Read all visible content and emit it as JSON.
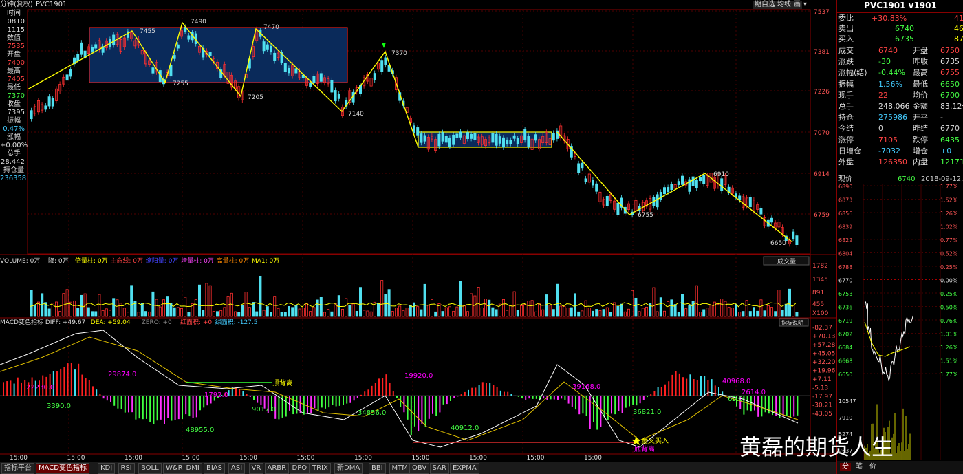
{
  "topbar": {
    "title_prefix": "分钟(复权)",
    "symbol": "PVC1901",
    "buttons": [
      "期自选",
      "均线",
      "画"
    ]
  },
  "left_info": [
    {
      "label": "时间",
      "value": "0810",
      "color": "#ddd"
    },
    {
      "label": "",
      "value": "1115",
      "color": "#ddd"
    },
    {
      "label": "数值",
      "value": "7535",
      "color": "#f44"
    },
    {
      "label": "开盘",
      "value": "7400",
      "color": "#f44"
    },
    {
      "label": "最高",
      "value": "7405",
      "color": "#f44"
    },
    {
      "label": "最低",
      "value": "7370",
      "color": "#4f4"
    },
    {
      "label": "收盘",
      "value": "7395",
      "color": "#ddd"
    },
    {
      "label": "振幅",
      "value": "0.47%",
      "color": "#4cf"
    },
    {
      "label": "涨幅",
      "value": "+0.00%",
      "color": "#ddd"
    },
    {
      "label": "总手",
      "value": "28,442",
      "color": "#ddd"
    },
    {
      "label": "持仓量",
      "value": "236358",
      "color": "#4cf"
    }
  ],
  "price_axis": [
    "7537",
    "7381",
    "7226",
    "7070",
    "6914",
    "6759"
  ],
  "chart_data": {
    "type": "candlestick",
    "annotations": [
      {
        "label": "7455",
        "value": 7455
      },
      {
        "label": "7490",
        "value": 7490
      },
      {
        "label": "7470",
        "value": 7470
      },
      {
        "label": "7255",
        "value": 7255
      },
      {
        "label": "7205",
        "value": 7205
      },
      {
        "label": "7370",
        "value": 7370
      },
      {
        "label": "7140",
        "value": 7140
      },
      {
        "label": "6910",
        "value": 6910
      },
      {
        "label": "6755",
        "value": 6755
      },
      {
        "label": "6650",
        "value": 6650
      }
    ]
  },
  "volume_panel": {
    "legend": [
      {
        "text": "VOLUME: 0万",
        "color": "#ddd"
      },
      {
        "text": "降: 0万",
        "color": "#ddd"
      },
      {
        "text": "倍量柱: 0万",
        "color": "#ff0"
      },
      {
        "text": "主命线: 0万",
        "color": "#f44"
      },
      {
        "text": "缩阳量: 0万",
        "color": "#44f"
      },
      {
        "text": "增量柱: 0万",
        "color": "#f4f"
      },
      {
        "text": "高量柱: 0万",
        "color": "#f80"
      },
      {
        "text": "MA1: 0万",
        "color": "#ff0"
      }
    ],
    "dropdown": "成交量",
    "axis": [
      "1782",
      "1345",
      "891",
      "455",
      "X100"
    ]
  },
  "macd_panel": {
    "legend": [
      {
        "text": "MACD变色指标 DIFF: +49.67",
        "color": "#ddd"
      },
      {
        "text": "DEA: +59.04",
        "color": "#ff0"
      },
      {
        "text": "ZERO: +0",
        "color": "#888"
      },
      {
        "text": "红面积: +0",
        "color": "#f44"
      },
      {
        "text": "绿面积: -127.5",
        "color": "#4cf"
      }
    ],
    "button": "指标说明",
    "axis": [
      "-82.37",
      "+70.13",
      "+57.28",
      "+45.05",
      "+32.20",
      "+19.96",
      "+7.11",
      "-5.13",
      "-17.97",
      "-30.21",
      "-43.05"
    ],
    "labels": [
      {
        "text": "22230.0",
        "color": "#f0f"
      },
      {
        "text": "29874.0",
        "color": "#f0f"
      },
      {
        "text": "3390.0",
        "color": "#4f4"
      },
      {
        "text": "1792.0",
        "color": "#f0f"
      },
      {
        "text": "9017.0",
        "color": "#4f4"
      },
      {
        "text": "48955.0",
        "color": "#4f4"
      },
      {
        "text": "34856.0",
        "color": "#4f4"
      },
      {
        "text": "19920.0",
        "color": "#f0f"
      },
      {
        "text": "40912.0",
        "color": "#4f4"
      },
      {
        "text": "39168.0",
        "color": "#f0f"
      },
      {
        "text": "36821.0",
        "color": "#4f4"
      },
      {
        "text": "40968.0",
        "color": "#f0f"
      },
      {
        "text": "65.0",
        "color": "#4f4"
      },
      {
        "text": "2614.0",
        "color": "#f0f"
      }
    ],
    "signals": [
      {
        "text": "顶背离",
        "color": "#ff0"
      },
      {
        "text": "金叉买入",
        "color": "#ff0"
      },
      {
        "text": "底背离",
        "color": "#f0f"
      }
    ]
  },
  "time_labels": [
    "15:00",
    "15:00",
    "15:00",
    "15:00",
    "15:00",
    "15:00",
    "15:00",
    "15:00",
    "15:00",
    "15:00",
    "15:00"
  ],
  "bottom_tabs": [
    "指标平台",
    "MACD变色指标",
    "KDJ",
    "RSI",
    "BOLL",
    "W&R",
    "DMI",
    "BIAS",
    "ASI",
    "VR",
    "ARBR",
    "DPO",
    "TRIX",
    "新DMA",
    "BBI",
    "MTM",
    "OBV",
    "SAR",
    "EXPMA"
  ],
  "right_panel": {
    "title": "PVC1901 v1901",
    "weibi": {
      "label": "委比",
      "value": "+30.83%",
      "extra": "41"
    },
    "sell": {
      "label": "卖出",
      "price": "6740",
      "qty": "46"
    },
    "buy": {
      "label": "买入",
      "price": "6735",
      "qty": "87"
    },
    "rows": [
      {
        "l1": "成交",
        "v1": "6740",
        "l2": "开盘",
        "v2": "6750",
        "c1": "#f44",
        "c2": "#f44"
      },
      {
        "l1": "涨跌",
        "v1": "-30",
        "l2": "昨收",
        "v2": "6735",
        "c1": "#4f4",
        "c2": "#ddd"
      },
      {
        "l1": "涨幅(结)",
        "v1": "-0.44%",
        "l2": "最高",
        "v2": "6755",
        "c1": "#4f4",
        "c2": "#f44"
      },
      {
        "l1": "振幅",
        "v1": "1.56%",
        "l2": "最低",
        "v2": "6650",
        "c1": "#4cf",
        "c2": "#4f4"
      },
      {
        "l1": "现手",
        "v1": "22",
        "l2": "均价",
        "v2": "6700",
        "c1": "#f44",
        "c2": "#4f4"
      },
      {
        "l1": "总手",
        "v1": "248,066",
        "l2": "金额",
        "v2": "83.12亿",
        "c1": "#ddd",
        "c2": "#ddd"
      },
      {
        "l1": "持仓",
        "v1": "275986",
        "l2": "开平",
        "v2": "-",
        "c1": "#4cf",
        "c2": "#ddd"
      },
      {
        "l1": "今结",
        "v1": "0",
        "l2": "昨结",
        "v2": "6770",
        "c1": "#ddd",
        "c2": "#ddd"
      },
      {
        "l1": "涨停",
        "v1": "7105",
        "l2": "跌停",
        "v2": "6435",
        "c1": "#f44",
        "c2": "#4f4"
      },
      {
        "l1": "日增仓",
        "v1": "-7032",
        "l2": "增仓",
        "v2": "+0",
        "c1": "#4cf",
        "c2": "#4cf"
      },
      {
        "l1": "外盘",
        "v1": "126350",
        "l2": "内盘",
        "v2": "121716",
        "c1": "#f44",
        "c2": "#4f4"
      }
    ],
    "now_label": "现价",
    "now_price": "6740",
    "date": "2018-09-12,三",
    "mini_left_axis": [
      "6890",
      "6873",
      "6856",
      "6839",
      "6822",
      "6804",
      "6788",
      "6770",
      "6753",
      "6736",
      "6719",
      "6702",
      "6684",
      "6668",
      "6650"
    ],
    "mini_right_axis": [
      "1.77%",
      "1.52%",
      "1.26%",
      "1.02%",
      "0.77%",
      "0.52%",
      "0.25%",
      "0.00%",
      "0.25%",
      "0.50%",
      "0.76%",
      "1.01%",
      "1.26%",
      "1.51%",
      "1.77%"
    ],
    "vol_axis": [
      "10547",
      "7910",
      "5274",
      "2637"
    ],
    "bottom_tabs": [
      "分",
      "笔",
      "价"
    ]
  },
  "watermark": "黄磊的期货人生"
}
